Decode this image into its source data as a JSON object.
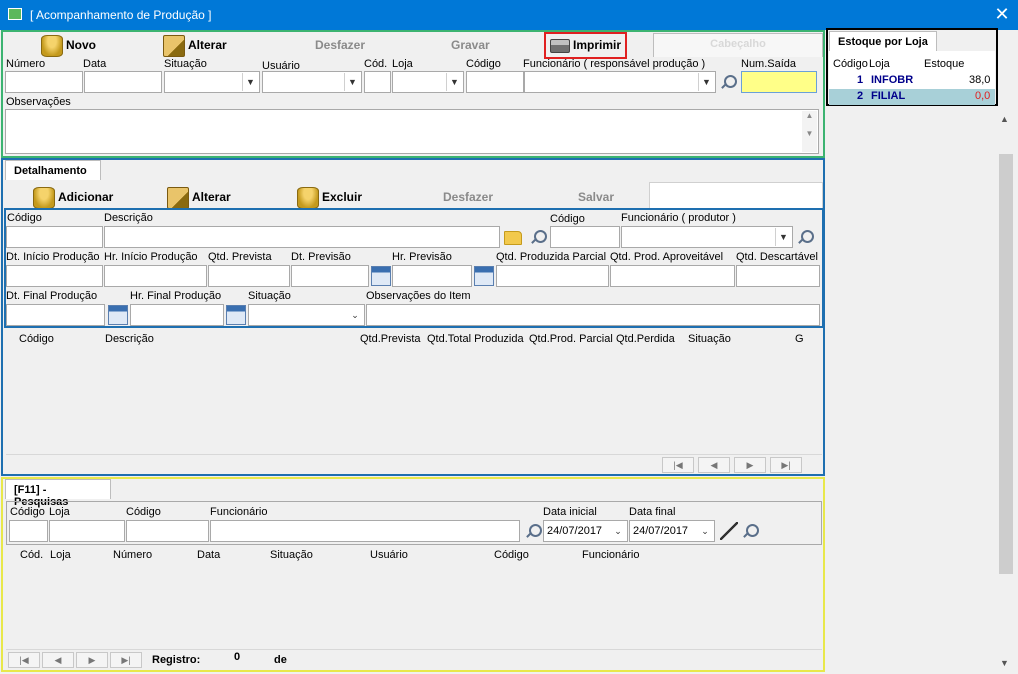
{
  "window": {
    "title": "[ Acompanhamento de Produção ]",
    "close": "✕"
  },
  "toolbar": {
    "novo": "Novo",
    "alterar": "Alterar",
    "desfazer": "Desfazer",
    "gravar": "Gravar",
    "imprimir": "Imprimir",
    "tab_cabecalho": "Cabeçalho"
  },
  "header_fields": {
    "numero": "Número",
    "data": "Data",
    "situacao": "Situação",
    "usuario": "Usuário",
    "cod": "Cód.",
    "loja": "Loja",
    "codigo": "Código",
    "funcionario": "Funcionário ( responsável produção )",
    "num_saida": "Num.Saída",
    "observacoes": "Observações"
  },
  "estoque": {
    "tab": "Estoque por Loja",
    "col_codigo": "Código",
    "col_loja": "Loja",
    "col_estoque": "Estoque",
    "rows": [
      {
        "code": "1",
        "loja": "INFOBR",
        "estoque": "38,0"
      },
      {
        "code": "2",
        "loja": "FILIAL",
        "estoque": "0,0"
      }
    ]
  },
  "detalhamento": {
    "tab": "Detalhamento",
    "adicionar": "Adicionar",
    "alterar": "Alterar",
    "excluir": "Excluir",
    "desfazer": "Desfazer",
    "salvar": "Salvar",
    "codigo": "Código",
    "descricao": "Descrição",
    "codigo2": "Código",
    "funcionario_produtor": "Funcionário ( produtor )",
    "dt_inicio": "Dt. Início Produção",
    "hr_inicio": "Hr. Início Produção",
    "qtd_prevista": "Qtd. Prevista",
    "dt_previsao": "Dt. Previsão",
    "hr_previsao": "Hr. Previsão",
    "qtd_produzida_parcial": "Qtd. Produzida Parcial",
    "qtd_prod_aproveitavel": "Qtd. Prod. Aproveitável",
    "qtd_descartavel": "Qtd. Descartável",
    "dt_final": "Dt. Final Produção",
    "hr_final": "Hr. Final Produção",
    "situacao": "Situação",
    "observacoes_item": "Observações do Item",
    "grid_headers": [
      "Código",
      "Descrição",
      "Qtd.Prevista",
      "Qtd.Total Produzida",
      "Qtd.Prod. Parcial",
      "Qtd.Perdida",
      "Situação",
      "G"
    ]
  },
  "pesquisas": {
    "tab": "[F11] - Pesquisas",
    "codigo": "Código",
    "loja": "Loja",
    "codigo2": "Código",
    "funcionario": "Funcionário",
    "data_inicial": "Data inicial",
    "data_final": "Data final",
    "data_inicial_value": "24/07/2017",
    "data_final_value": "24/07/2017",
    "grid_headers": [
      "Cód.",
      "Loja",
      "Número",
      "Data",
      "Situação",
      "Usuário",
      "Código",
      "Funcionário"
    ],
    "registro_label": "Registro:",
    "registro_value": "0",
    "de_label": "de"
  },
  "nav": {
    "first": "|◀",
    "prev": "◀",
    "next": "▶",
    "last": "▶|"
  },
  "colors": {
    "titlebar": "#0078d7",
    "green": "#3cb371",
    "blue": "#1e6fb0",
    "yellow": "#e8e84a",
    "highlight": "#ffff88"
  }
}
